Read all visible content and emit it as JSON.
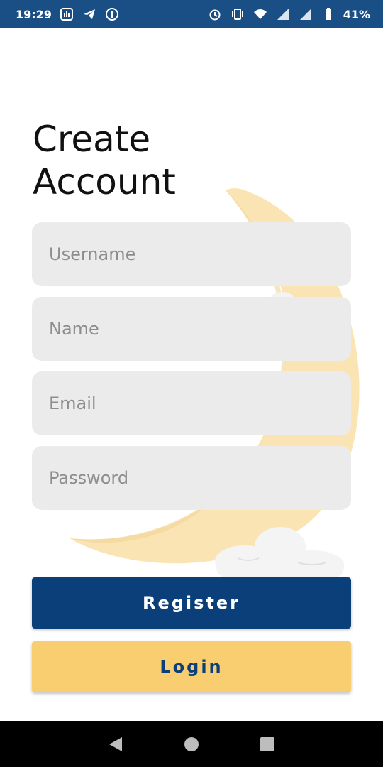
{
  "status_bar": {
    "time": "19:29",
    "battery": "41%",
    "icons_left": [
      "hand-badge-icon",
      "telegram-icon",
      "keyhole-icon"
    ],
    "icons_right": [
      "alarm-icon",
      "vibrate-icon",
      "wifi-icon",
      "signal-icon",
      "signal-icon",
      "battery-icon"
    ]
  },
  "page": {
    "title": "Create Account"
  },
  "form": {
    "username_placeholder": "Username",
    "name_placeholder": "Name",
    "email_placeholder": "Email",
    "password_placeholder": "Password"
  },
  "actions": {
    "register_label": "Register",
    "login_label": "Login"
  },
  "colors": {
    "status_bar": "#1a4f86",
    "primary": "#0b3f79",
    "accent": "#f8ce71",
    "moon": "#fbe4b4",
    "field_bg": "#ebebeb"
  },
  "nav_bar": {
    "buttons": [
      "back-icon",
      "home-icon",
      "recents-icon"
    ]
  }
}
